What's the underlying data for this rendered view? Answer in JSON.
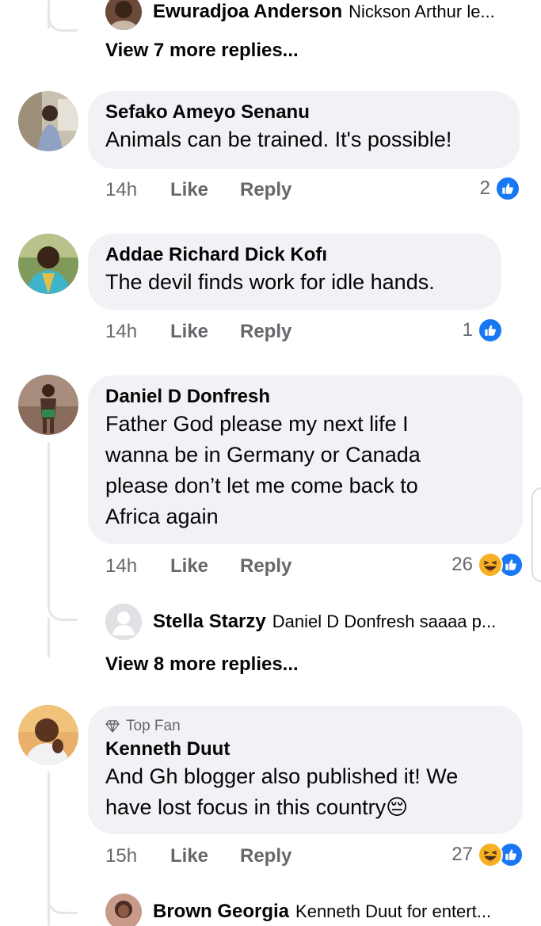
{
  "thread_top": {
    "reply_preview": {
      "name": "Ewuradjoa Anderson",
      "snippet": "Nickson Arthur le..."
    },
    "view_more": "View 7 more replies..."
  },
  "comments": [
    {
      "name": "Sefako Ameyo Senanu",
      "text": "Animals can be trained. It's possible!",
      "time": "14h",
      "like_label": "Like",
      "reply_label": "Reply",
      "reaction_count": "2",
      "reactions": [
        "like-icon"
      ]
    },
    {
      "name": "Addae Richard Dick Kofı",
      "text": "The devil finds work for idle hands.",
      "time": "14h",
      "like_label": "Like",
      "reply_label": "Reply",
      "reaction_count": "1",
      "reactions": [
        "like-icon"
      ]
    },
    {
      "name": "Daniel D Donfresh",
      "text_lines": [
        "Father God please my next life I",
        "wanna be in Germany or Canada",
        "please don’t let me come back to",
        "Africa again"
      ],
      "time": "14h",
      "like_label": "Like",
      "reply_label": "Reply",
      "reaction_count": "26",
      "reactions": [
        "haha-icon",
        "like-icon"
      ],
      "reply_preview": {
        "name": "Stella Starzy",
        "snippet": "Daniel D Donfresh saaaa p..."
      },
      "view_more": "View 8 more replies..."
    },
    {
      "badge": "Top Fan",
      "name": "Kenneth Duut",
      "text_lines": [
        "And Gh blogger also published it! We",
        "have lost focus in this country😔"
      ],
      "time": "15h",
      "like_label": "Like",
      "reply_label": "Reply",
      "reaction_count": "27",
      "reactions": [
        "haha-icon",
        "like-icon"
      ],
      "reply_preview": {
        "name": "Brown Georgia",
        "snippet": "Kenneth Duut for entert..."
      }
    }
  ],
  "colors": {
    "bubble": "#f0f2f5",
    "meta": "#65676b",
    "like_blue": "#1877f2",
    "haha_yellow": "#f7b125"
  }
}
